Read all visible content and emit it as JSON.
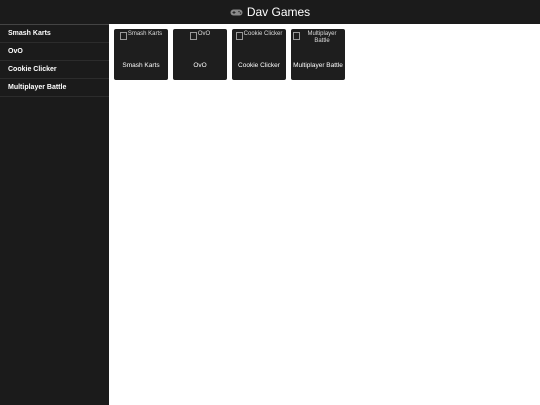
{
  "header": {
    "title": "Dav Games",
    "icon": "gamepad-icon"
  },
  "sidebar": {
    "items": [
      {
        "label": "Smash Karts"
      },
      {
        "label": "OvO"
      },
      {
        "label": "Cookie Clicker"
      },
      {
        "label": "Multiplayer Battle"
      }
    ]
  },
  "games": [
    {
      "thumb_alt": "Smash Karts",
      "title": "Smash Karts"
    },
    {
      "thumb_alt": "OvO",
      "title": "OvO"
    },
    {
      "thumb_alt": "Cookie Clicker",
      "title": "Cookie Clicker"
    },
    {
      "thumb_alt": "Multiplayer Battle",
      "title": "Multiplayer Battle"
    }
  ],
  "colors": {
    "header_bg": "#1b1b1b",
    "sidebar_bg": "#1b1b1b",
    "card_bg": "#1e1e1e",
    "text": "#ffffff"
  }
}
